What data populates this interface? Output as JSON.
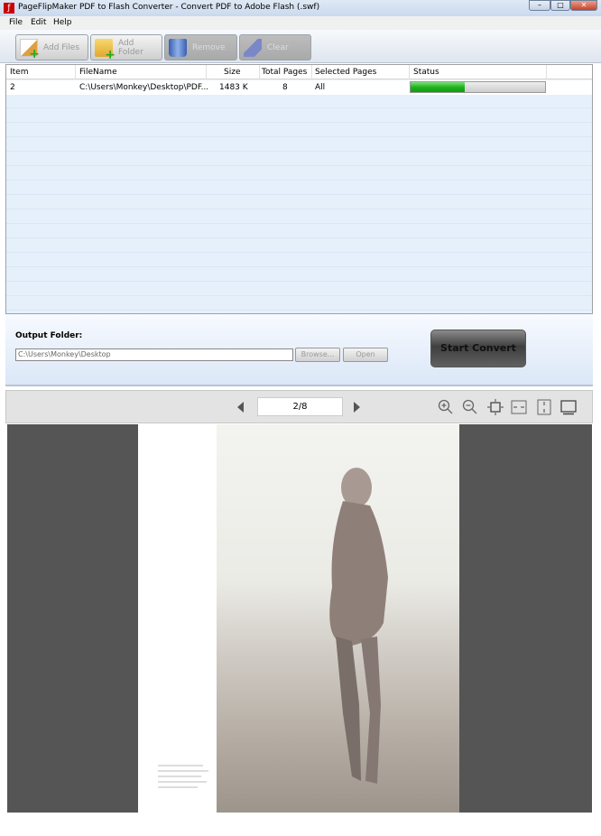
{
  "window": {
    "title": "PageFlipMaker PDF to Flash Converter - Convert PDF to Adobe Flash (.swf)",
    "controls": [
      "minimize",
      "maximize",
      "close"
    ]
  },
  "menu": [
    "File",
    "Edit",
    "Help"
  ],
  "toolbar": {
    "add_files": "Add Files",
    "add_folder": "Add Folder",
    "remove": "Remove",
    "clear": "Clear"
  },
  "table": {
    "columns": [
      "Item",
      "FileName",
      "Size",
      "Total Pages",
      "Selected Pages",
      "Status"
    ],
    "rows": [
      {
        "item": "2",
        "filename": "C:\\Users\\Monkey\\Desktop\\PDF...",
        "size": "1483 K",
        "total_pages": "8",
        "selected_pages": "All",
        "progress_percent": 40
      }
    ]
  },
  "output": {
    "label": "Output Folder:",
    "path": "C:\\Users\\Monkey\\Desktop",
    "browse": "Browse...",
    "open": "Open",
    "start": "Start Convert"
  },
  "viewer": {
    "page_indicator": "2/8",
    "icons": [
      "zoom-in",
      "zoom-out",
      "fit-page",
      "fit-width",
      "fit-height",
      "full-screen"
    ]
  },
  "colors": {
    "progress": "#1fb31f",
    "viewer_bg": "#555555"
  }
}
